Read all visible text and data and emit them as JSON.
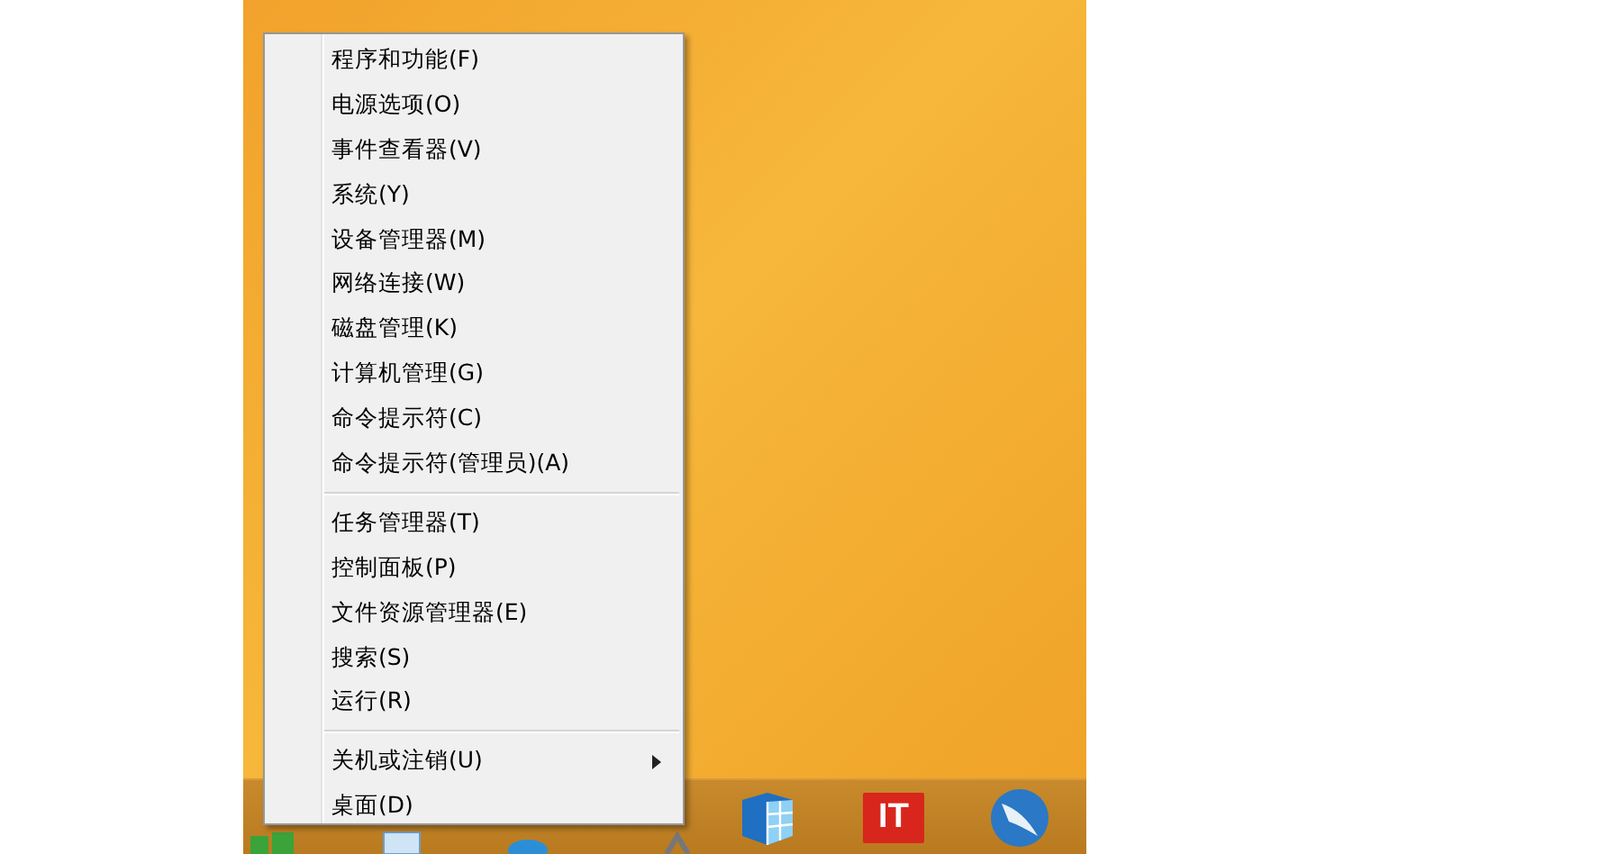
{
  "context_menu": {
    "groups": [
      {
        "items": [
          {
            "label": "程序和功能(F)",
            "submenu": false
          },
          {
            "label": "电源选项(O)",
            "submenu": false
          },
          {
            "label": "事件查看器(V)",
            "submenu": false
          },
          {
            "label": "系统(Y)",
            "submenu": false
          },
          {
            "label": "设备管理器(M)",
            "submenu": false
          },
          {
            "label": "网络连接(W)",
            "submenu": false
          },
          {
            "label": "磁盘管理(K)",
            "submenu": false
          },
          {
            "label": "计算机管理(G)",
            "submenu": false
          },
          {
            "label": "命令提示符(C)",
            "submenu": false
          },
          {
            "label": "命令提示符(管理员)(A)",
            "submenu": false
          }
        ]
      },
      {
        "items": [
          {
            "label": "任务管理器(T)",
            "submenu": false
          },
          {
            "label": "控制面板(P)",
            "submenu": false
          },
          {
            "label": "文件资源管理器(E)",
            "submenu": false
          },
          {
            "label": "搜索(S)",
            "submenu": false
          },
          {
            "label": "运行(R)",
            "submenu": false
          }
        ]
      },
      {
        "items": [
          {
            "label": "关机或注销(U)",
            "submenu": true
          },
          {
            "label": "桌面(D)",
            "submenu": false
          }
        ]
      }
    ]
  },
  "taskbar": {
    "pinned": [
      {
        "kind": "cube"
      },
      {
        "kind": "logo",
        "label": "IT"
      },
      {
        "kind": "globe"
      }
    ]
  }
}
